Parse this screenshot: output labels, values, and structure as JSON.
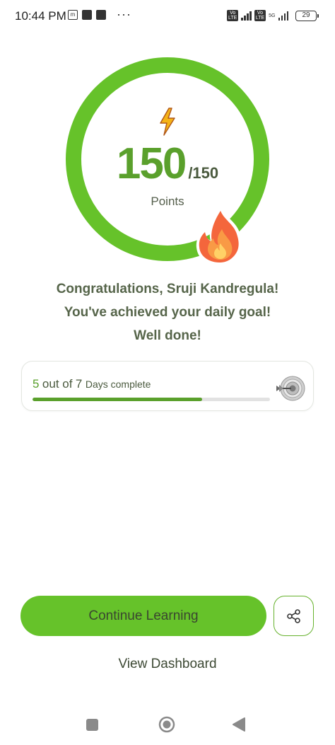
{
  "status_bar": {
    "time": "10:44 PM",
    "left_icons": [
      "m-icon",
      "notification-icon",
      "notification-icon"
    ],
    "more": "···",
    "volte_label": "Vo LTE",
    "network": "5G",
    "battery": "29"
  },
  "score": {
    "value": "150",
    "max": "/150",
    "label": "Points",
    "progress_fraction": 1.0,
    "ring_color": "#66c22a"
  },
  "messages": {
    "line1": "Congratulations, Sruji Kandregula!",
    "line2": "You've achieved your daily goal!",
    "line3": "Well done!"
  },
  "days_progress": {
    "completed": "5",
    "out_of": "out of",
    "total": "7",
    "suffix": "Days complete",
    "fraction": 0.714
  },
  "actions": {
    "continue_label": "Continue Learning",
    "dashboard_label": "View Dashboard",
    "share_icon": "share-icon"
  },
  "colors": {
    "accent": "#5aa02c",
    "button": "#66c22a"
  }
}
